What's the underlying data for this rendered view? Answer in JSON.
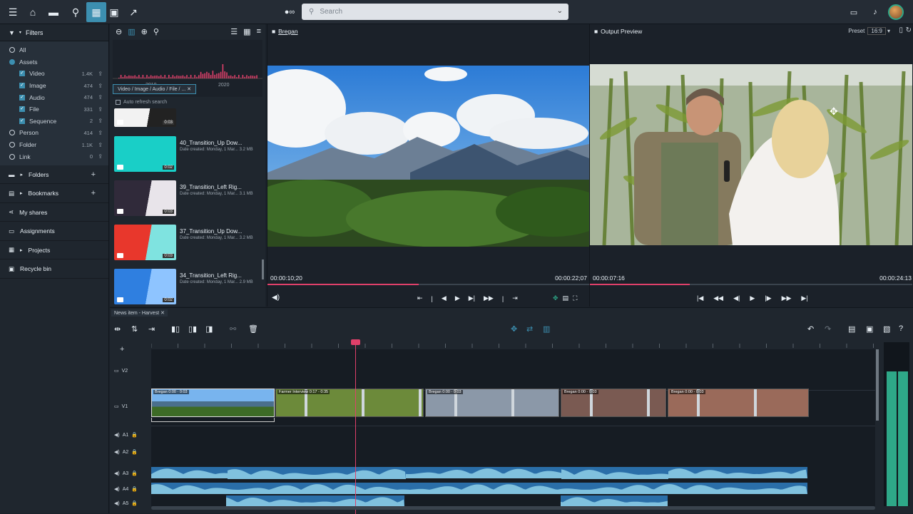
{
  "topbar": {
    "search_placeholder": "Search",
    "icons": [
      "menu-icon",
      "home-icon",
      "folder-icon",
      "people-search-icon",
      "filmstrip-icon",
      "calendar-icon",
      "trend-icon",
      "info-icon",
      "bell-icon"
    ]
  },
  "filters": {
    "header": "Filters",
    "tree": [
      {
        "label": "All",
        "kind": "radio",
        "checked": false,
        "count": ""
      },
      {
        "label": "Assets",
        "kind": "radio",
        "checked": true,
        "count": ""
      },
      {
        "label": "Video",
        "kind": "check",
        "count": "1.4K"
      },
      {
        "label": "Image",
        "kind": "check",
        "count": "474"
      },
      {
        "label": "Audio",
        "kind": "check",
        "count": "474"
      },
      {
        "label": "File",
        "kind": "check",
        "count": "331"
      },
      {
        "label": "Sequence",
        "kind": "check",
        "count": "2"
      },
      {
        "label": "Person",
        "kind": "radio",
        "checked": false,
        "count": "414"
      },
      {
        "label": "Folder",
        "kind": "radio",
        "checked": false,
        "count": "1.1K"
      },
      {
        "label": "Link",
        "kind": "radio",
        "checked": false,
        "count": "0"
      }
    ],
    "sections": [
      "Folders",
      "Bookmarks",
      "My shares",
      "Assignments",
      "Projects",
      "Recycle bin"
    ]
  },
  "assets": {
    "histogram_labels": [
      "2010",
      "2020"
    ],
    "breadcrumb": "Video / Image / Audio / File / ...",
    "auto_refresh": "Auto refresh search",
    "items": [
      {
        "name": "",
        "meta": "",
        "duration": "0:03",
        "color1": "#f2f2f2",
        "color2": "#222"
      },
      {
        "name": "40_Transition_Up Dow...",
        "meta": "Date created: Monday, 1 Mar... 3.2 MB",
        "duration": "0:02",
        "color1": "#19cfc7",
        "color2": "#19cfc7"
      },
      {
        "name": "39_Transition_Left Rig...",
        "meta": "Date created: Monday, 1 Mar... 3.1 MB",
        "duration": "0:03",
        "color1": "#302a3a",
        "color2": "#e8e4ea"
      },
      {
        "name": "37_Transition_Up Dow...",
        "meta": "Date created: Monday, 1 Mar... 3.2 MB",
        "duration": "0:03",
        "color1": "#e8372c",
        "color2": "#7fe3e0"
      },
      {
        "name": "34_Transition_Left Rig...",
        "meta": "Date created: Monday, 1 Mar... 2.9 MB",
        "duration": "0:02",
        "color1": "#2f7fe0",
        "color2": "#8ec4ff"
      }
    ]
  },
  "source": {
    "title": "Bregan",
    "time_current": "00:00:10;20",
    "time_total": "00:00:22;07",
    "progress": 0.47
  },
  "output": {
    "title": "Output Preview",
    "preset_label": "Preset",
    "preset_value": "16:9",
    "time_current": "00:00:07:16",
    "time_total": "00:00:24:13",
    "progress": 0.31
  },
  "timeline": {
    "tab": "News item - Harvest",
    "tracks": [
      "V2",
      "V1",
      "A1",
      "A2",
      "A3",
      "A4",
      "A5"
    ],
    "clips": [
      {
        "label": "Bregan 0:00 - 0:03",
        "color": "#5b8fc9"
      },
      {
        "label": "Farmer Interview 0:17 - 0:35",
        "color": "#6c8a3a"
      },
      {
        "label": "Bregan 0:00 - 0:03",
        "color": "#8b98a8"
      },
      {
        "label": "Bregan 0:00 - 0:03",
        "color": "#7a5a52"
      },
      {
        "label": "Bregan 0:00 - 0:03",
        "color": "#9a6a5a"
      }
    ]
  }
}
